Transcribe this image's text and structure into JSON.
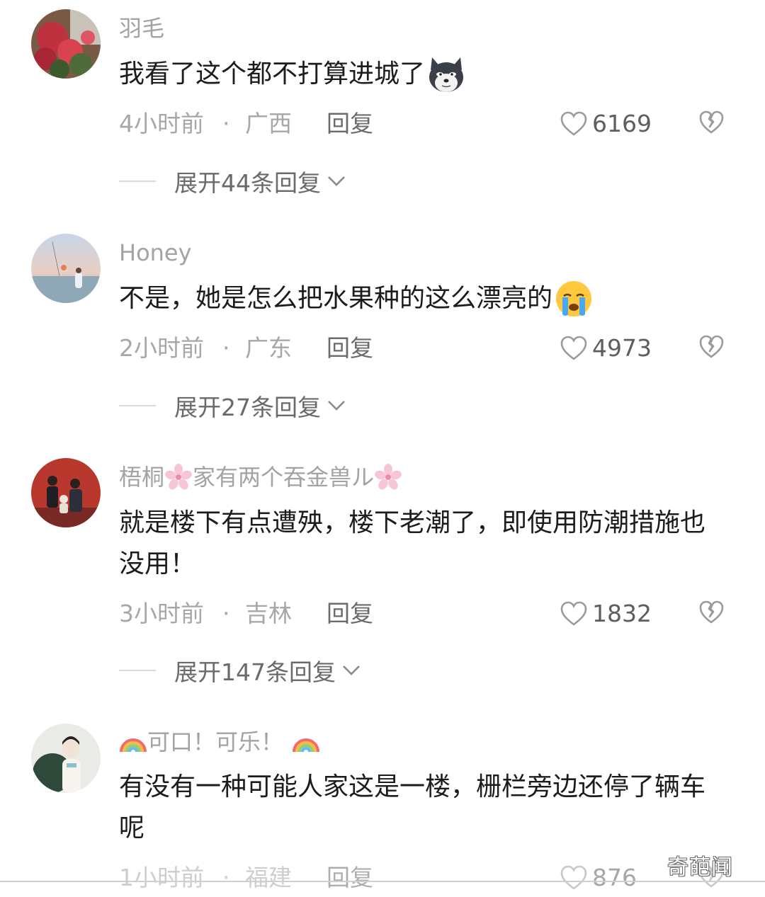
{
  "comments": [
    {
      "username": "羽毛",
      "text": "我看了这个都不打算进城了",
      "emoji": "husky-dog-emoji",
      "time": "4小时前",
      "separator": "·",
      "location": "广西",
      "reply_label": "回复",
      "likes": "6169",
      "expand_label": "展开44条回复"
    },
    {
      "username": "Honey",
      "text": "不是，她是怎么把水果种的这么漂亮的",
      "emoji": "crying-face-emoji",
      "time": "2小时前",
      "separator": "·",
      "location": "广东",
      "reply_label": "回复",
      "likes": "4973",
      "expand_label": "展开27条回复"
    },
    {
      "username_parts": [
        "梧桐",
        "家有两个吞金兽ル"
      ],
      "username_deco": "cherry-blossom-icon",
      "text": "就是楼下有点遭殃，楼下老潮了，即使用防潮措施也没用！",
      "time": "3小时前",
      "separator": "·",
      "location": "吉林",
      "reply_label": "回复",
      "likes": "1832",
      "expand_label": "展开147条回复"
    },
    {
      "username": "可口！可乐！",
      "username_deco": "rainbow-icon",
      "text": "有没有一种可能人家这是一楼，栅栏旁边还停了辆车呢",
      "time": "1小时前",
      "separator": "·",
      "location": "福建",
      "reply_label": "回复",
      "likes": "876"
    }
  ],
  "watermark": "奇葩闻",
  "colors": {
    "username": "#a3a3a3",
    "text": "#1c1c1c",
    "meta": "#a7a7a7"
  }
}
